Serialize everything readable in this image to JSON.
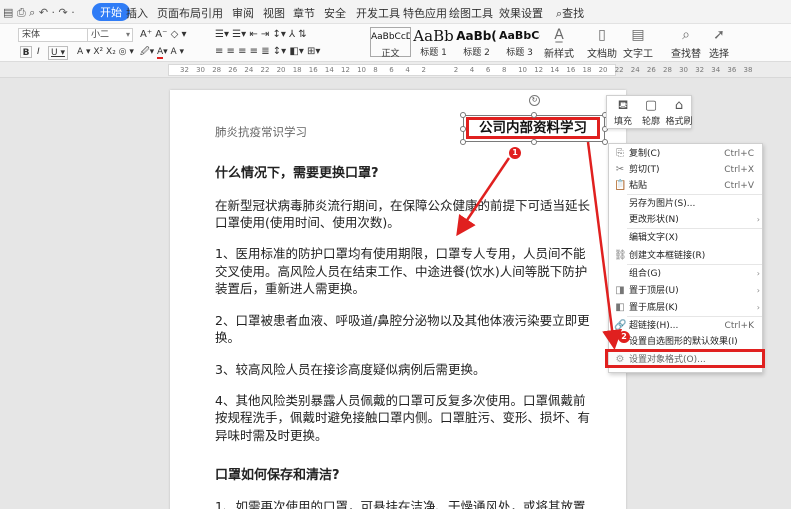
{
  "menubar": {
    "tabs": [
      {
        "label": "开始",
        "active": true
      },
      {
        "label": "插入"
      },
      {
        "label": "页面布局"
      },
      {
        "label": "引用"
      },
      {
        "label": "审阅"
      },
      {
        "label": "视图"
      },
      {
        "label": "章节"
      },
      {
        "label": "安全"
      },
      {
        "label": "开发工具"
      },
      {
        "label": "特色应用"
      },
      {
        "label": "绘图工具"
      },
      {
        "label": "效果设置"
      }
    ],
    "search_label": "查找"
  },
  "ribbon": {
    "font_name": "宋体",
    "font_size": "小二",
    "styles": [
      {
        "sample": "AaBbCcDd",
        "label": "正文"
      },
      {
        "sample": "AaBb",
        "label": "标题 1"
      },
      {
        "sample": "AaBb(",
        "label": "标题 2"
      },
      {
        "sample": "AaBbCc",
        "label": "标题 3"
      }
    ],
    "new_style_label": "新样式",
    "text_assistant_label": "文档助手",
    "text_tools_label": "文字工具",
    "find_replace_label": "查找替换",
    "select_label": "选择"
  },
  "ruler": {
    "ticks": [
      "32",
      "30",
      "28",
      "26",
      "24",
      "22",
      "20",
      "18",
      "16",
      "14",
      "12",
      "10",
      "8",
      "6",
      "4",
      "2",
      "",
      "2",
      "4",
      "6",
      "8",
      "10",
      "12",
      "14",
      "16",
      "18",
      "20",
      "22",
      "24",
      "26",
      "28",
      "30",
      "32",
      "34",
      "36",
      "38"
    ]
  },
  "document": {
    "header": "肺炎抗疫常识学习",
    "textbox": "公司内部资料学习",
    "lines": [
      {
        "text": "什么情况下，需要更换口罩?",
        "heading": true
      },
      {
        "text": "在新型冠状病毒肺炎流行期间，在保障公众健康的前提下可适当延长"
      },
      {
        "text": "口罩使用(使用时间、使用次数)。"
      },
      {
        "text": "1、医用标准的防护口罩均有使用期限，口罩专人专用，人员间不能"
      },
      {
        "text": "交叉使用。高风险人员在结束工作、中途进餐(饮水)人间等脱下防护"
      },
      {
        "text": "装置后，重新进人需更换。"
      },
      {
        "text": "2、口罩被患者血液、呼吸道/鼻腔分泌物以及其他体液污染要立即更"
      },
      {
        "text": "换。"
      },
      {
        "text": "3、较高风险人员在接诊高度疑似病例后需更换。"
      },
      {
        "text": "4、其他风险类别暴露人员佩戴的口罩可反复多次使用。口罩佩戴前"
      },
      {
        "text": "按规程洗手，佩戴时避免接触口罩内侧。口罩脏污、变形、损坏、有"
      },
      {
        "text": "异味时需及时更换。"
      },
      {
        "text": "口罩如何保存和清洁?",
        "heading": true
      },
      {
        "text": "1、如需再次使用的口罩，可悬挂在洁净、干燥通风处，或将其放置"
      }
    ]
  },
  "floatbar": {
    "items": [
      {
        "label": "填充",
        "icon": "fill-bucket-icon"
      },
      {
        "label": "轮廓",
        "icon": "outline-icon"
      },
      {
        "label": "格式刷",
        "icon": "format-brush-icon"
      }
    ]
  },
  "context_menu": {
    "items": [
      {
        "label": "复制(C)",
        "shortcut": "Ctrl+C",
        "icon": "copy-icon"
      },
      {
        "label": "剪切(T)",
        "shortcut": "Ctrl+X",
        "icon": "cut-icon"
      },
      {
        "label": "粘贴",
        "shortcut": "Ctrl+V",
        "icon": "paste-icon"
      },
      {
        "label": "另存为图片(S)...",
        "icon": ""
      },
      {
        "label": "更改形状(N)",
        "arrow": true,
        "icon": ""
      },
      {
        "label": "编辑文字(X)",
        "icon": ""
      },
      {
        "label": "创建文本框链接(R)",
        "icon": "link-icon"
      },
      {
        "label": "组合(G)",
        "arrow": true,
        "icon": ""
      },
      {
        "label": "置于顶层(U)",
        "arrow": true,
        "icon": "bring-front-icon"
      },
      {
        "label": "置于底层(K)",
        "arrow": true,
        "icon": "send-back-icon"
      },
      {
        "label": "超链接(H)...",
        "shortcut": "Ctrl+K",
        "icon": "hyperlink-icon"
      },
      {
        "label": "设置自选图形的默认效果(I)",
        "icon": ""
      },
      {
        "label": "设置对象格式(O)...",
        "icon": "format-object-icon",
        "highlighted": true
      }
    ]
  },
  "annotations": {
    "badge1": "1",
    "badge2": "2"
  },
  "colors": {
    "accent": "#2f7cf6",
    "highlight_red": "#e0201f"
  }
}
